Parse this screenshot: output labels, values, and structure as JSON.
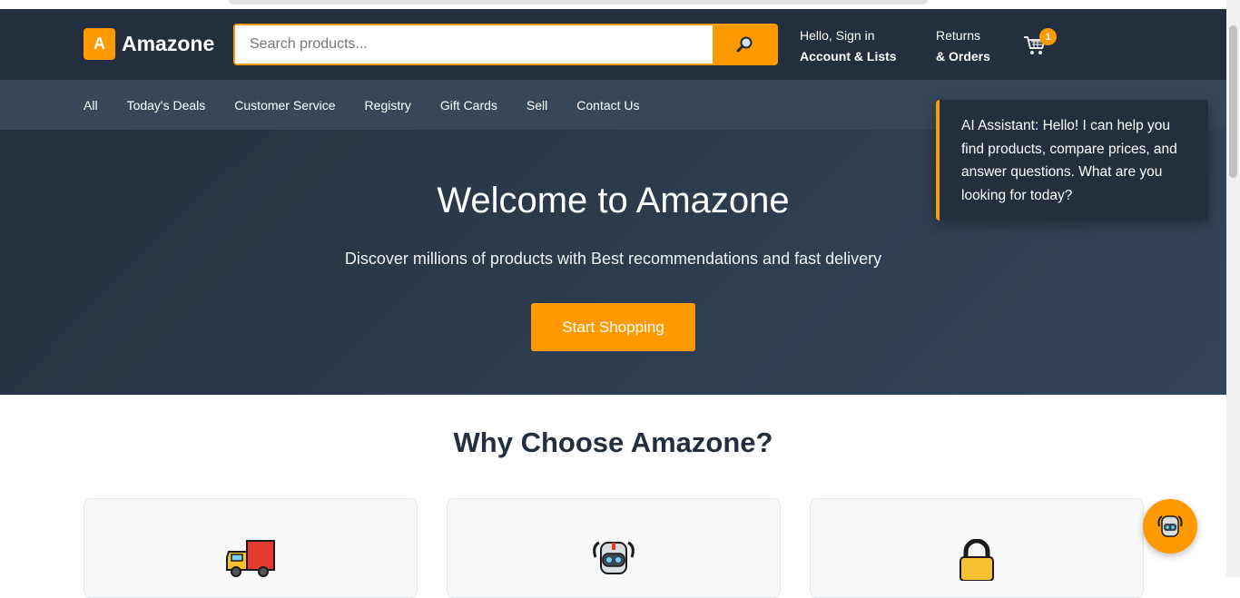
{
  "header": {
    "logo_letter": "A",
    "brand": "Amazone",
    "search": {
      "placeholder": "Search products...",
      "button_icon": "search-icon"
    },
    "account": {
      "greeting": "Hello, Sign in",
      "label": "Account & Lists"
    },
    "orders": {
      "line1": "Returns",
      "line2": "& Orders"
    },
    "cart": {
      "icon": "cart-icon",
      "count": "1"
    }
  },
  "nav": {
    "items": [
      "All",
      "Today's Deals",
      "Customer Service",
      "Registry",
      "Gift Cards",
      "Sell",
      "Contact Us"
    ]
  },
  "hero": {
    "title": "Welcome to Amazone",
    "subtitle": "Discover millions of products with Best recommendations and fast delivery",
    "cta": "Start Shopping"
  },
  "assistant": {
    "message": "AI Assistant: Hello! I can help you find products, compare prices, and answer questions. What are you looking for today?",
    "fab_icon": "robot-icon"
  },
  "features": {
    "title": "Why Choose Amazone?",
    "cards": [
      {
        "icon": "delivery-truck-icon"
      },
      {
        "icon": "robot-icon"
      },
      {
        "icon": "lock-icon"
      }
    ]
  },
  "colors": {
    "accent": "#ff9900",
    "header_bg": "#232f3e",
    "nav_bg": "#37475a"
  }
}
